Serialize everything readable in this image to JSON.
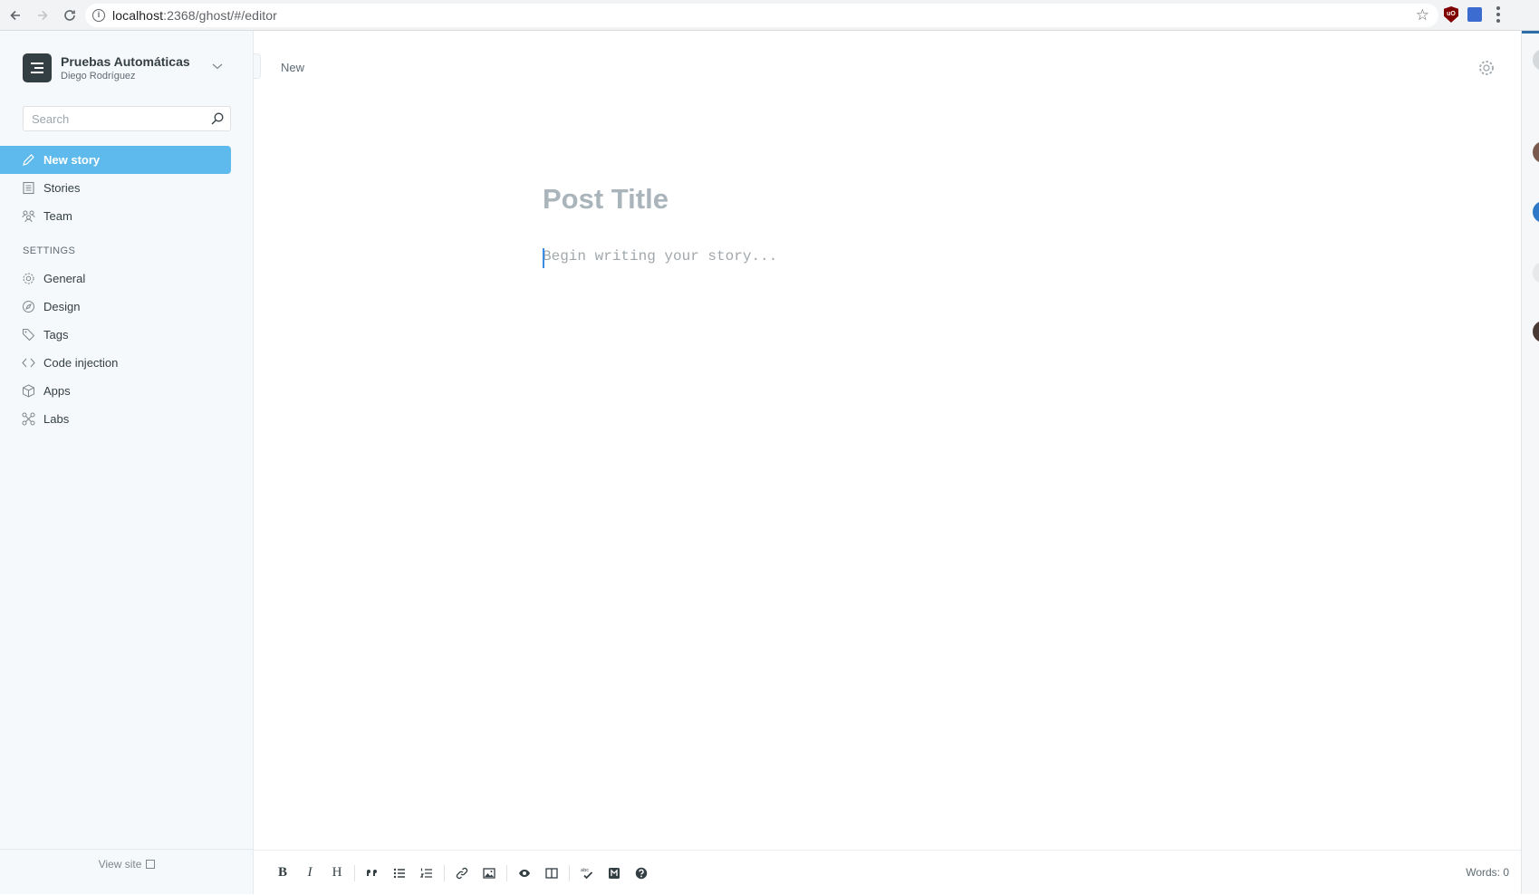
{
  "browser": {
    "url_host": "localhost",
    "url_rest": ":2368/ghost/#/editor"
  },
  "blog": {
    "title": "Pruebas Automáticas",
    "user": "Diego Rodríguez"
  },
  "search": {
    "placeholder": "Search"
  },
  "nav": {
    "new_story": "New story",
    "stories": "Stories",
    "team": "Team",
    "settings_heading": "SETTINGS",
    "general": "General",
    "design": "Design",
    "tags": "Tags",
    "code_injection": "Code injection",
    "apps": "Apps",
    "labs": "Labs"
  },
  "view_site": "View site",
  "editor": {
    "status": "New",
    "title_placeholder": "Post Title",
    "body_placeholder": "Begin writing your story...",
    "word_count": "Words: 0"
  },
  "toolbar": {
    "bold": "B",
    "italic": "I",
    "heading": "H"
  },
  "colors": {
    "accent": "#5ebaed",
    "sidebar_bg": "#f6f9fb",
    "logo_bg": "#343f44"
  }
}
